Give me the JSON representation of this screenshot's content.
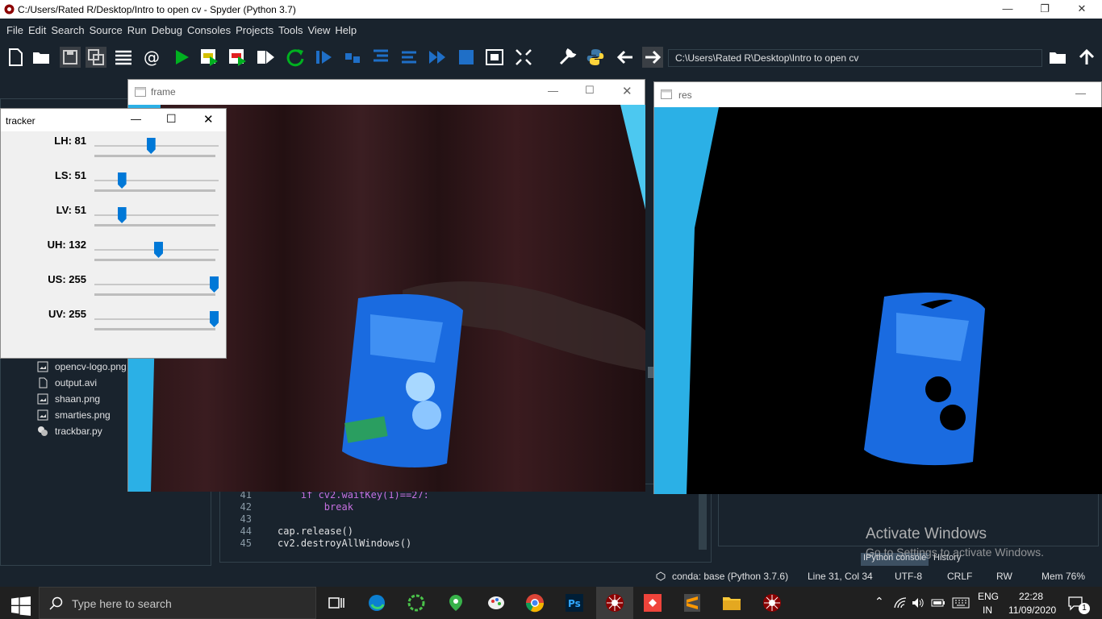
{
  "app": {
    "window_title": "C:/Users/Rated R/Desktop/Intro to open cv - Spyder (Python 3.7)"
  },
  "menu": [
    "File",
    "Edit",
    "Search",
    "Source",
    "Run",
    "Debug",
    "Consoles",
    "Projects",
    "Tools",
    "View",
    "Help"
  ],
  "toolbar": {
    "path": "C:\\Users\\Rated R\\Desktop\\Intro to open cv"
  },
  "files": [
    {
      "name": "opencv-logo.png",
      "icon": "image-file-icon"
    },
    {
      "name": "output.avi",
      "icon": "file-icon"
    },
    {
      "name": "shaan.png",
      "icon": "image-file-icon"
    },
    {
      "name": "smarties.png",
      "icon": "image-file-icon"
    },
    {
      "name": "trackbar.py",
      "icon": "python-file-icon"
    }
  ],
  "editor": {
    "lines": [
      {
        "num": "41",
        "code": "    if cv2.waitKey(1)==27:"
      },
      {
        "num": "42",
        "code": "        break"
      },
      {
        "num": "43",
        "code": ""
      },
      {
        "num": "44",
        "code": "cap.release()"
      },
      {
        "num": "45",
        "code": "cv2.destroyAllWindows()"
      }
    ]
  },
  "tracker": {
    "title": "tracker",
    "sliders": [
      {
        "label": "LH: 81",
        "value": 81,
        "max": 179
      },
      {
        "label": "LS: 51",
        "value": 51,
        "max": 255
      },
      {
        "label": "LV: 51",
        "value": 51,
        "max": 255
      },
      {
        "label": "UH: 132",
        "value": 132,
        "max": 255
      },
      {
        "label": "US: 255",
        "value": 255,
        "max": 255
      },
      {
        "label": "UV: 255",
        "value": 255,
        "max": 255
      }
    ]
  },
  "frame_window": {
    "title": "frame"
  },
  "res_window": {
    "title": "res"
  },
  "console_tabs": [
    "IPython console",
    "History"
  ],
  "activation": {
    "line1": "Activate Windows",
    "line2": "Go to Settings to activate Windows."
  },
  "statusbar": {
    "conda": "conda: base (Python 3.7.6)",
    "position": "Line 31, Col 34",
    "encoding": "UTF-8",
    "eol": "CRLF",
    "rw": "RW",
    "mem": "Mem 76%"
  },
  "taskbar": {
    "search_placeholder": "Type here to search",
    "lang1": "ENG",
    "lang2": "IN",
    "time": "22:28",
    "date": "11/09/2020",
    "notifications": "1"
  }
}
